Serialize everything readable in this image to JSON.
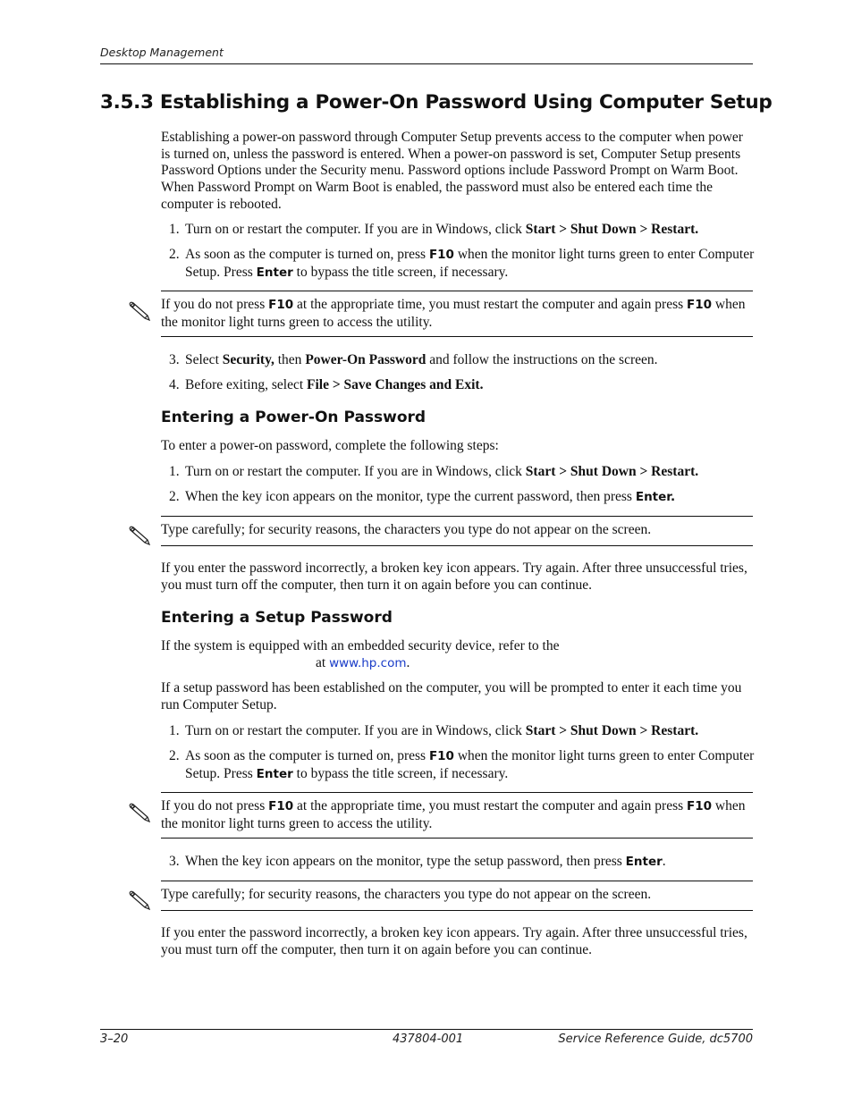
{
  "header": {
    "running_title": "Desktop Management"
  },
  "section": {
    "title": "3.5.3 Establishing a Power-On Password Using Computer Setup",
    "intro": "Establishing a power-on password through Computer Setup prevents access to the computer when power is turned on, unless the password is entered. When a power-on password is set, Computer Setup presents Password Options under the Security menu. Password options include Password Prompt on Warm Boot. When Password Prompt on Warm Boot is enabled, the password must also be entered each time the computer is rebooted.",
    "steps_a": [
      {
        "num": "1.",
        "pre": "Turn on or restart the computer. If you are in Windows, click ",
        "bold": "Start > Shut Down > Restart."
      },
      {
        "num": "2.",
        "pre": "As soon as the computer is turned on, press ",
        "key1": "F10",
        "mid": " when the monitor light turns green to enter Computer Setup. Press ",
        "key2": "Enter",
        "post": " to bypass the title screen, if necessary."
      }
    ],
    "note_1": {
      "pre": "If you do not press ",
      "key1": "F10",
      "mid": " at the appropriate time, you must restart the computer and again press ",
      "key2": "F10",
      "post": " when the monitor light turns green to access the utility."
    },
    "steps_b": [
      {
        "num": "3.",
        "pre": "Select ",
        "bold1": "Security,",
        "mid": " then ",
        "bold2": "Power-On Password",
        "post": " and follow the instructions on the screen."
      },
      {
        "num": "4.",
        "pre": "Before exiting, select ",
        "bold": "File > Save Changes and Exit."
      }
    ]
  },
  "entering_power_on": {
    "heading": "Entering a Power-On Password",
    "intro": "To enter a power-on password, complete the following steps:",
    "steps": [
      {
        "num": "1.",
        "pre": "Turn on or restart the computer. If you are in Windows, click ",
        "bold": "Start > Shut Down > Restart."
      },
      {
        "num": "2.",
        "pre": "When the key icon appears on the monitor, type the current password, then press ",
        "key": "Enter."
      }
    ],
    "note": "Type carefully; for security reasons, the characters you type do not appear on the screen.",
    "after": "If you enter the password incorrectly, a broken key icon appears. Try again. After three unsuccessful tries, you must turn off the computer, then turn it on again before you can continue."
  },
  "entering_setup": {
    "heading": "Entering a Setup Password",
    "embedded_pre": "If the system is equipped with an embedded security device, refer to the",
    "embedded_at": "at ",
    "link": "www.hp.com",
    "embedded_post": ".",
    "intro": "If a setup password has been established on the computer, you will be prompted to enter it each time you run Computer Setup.",
    "steps": [
      {
        "num": "1.",
        "pre": "Turn on or restart the computer. If you are in Windows, click ",
        "bold": "Start > Shut Down > Restart."
      },
      {
        "num": "2.",
        "pre": "As soon as the computer is turned on, press ",
        "key1": "F10",
        "mid": " when the monitor light turns green to enter Computer Setup. Press ",
        "key2": "Enter",
        "post": " to bypass the title screen, if necessary."
      }
    ],
    "note_1": {
      "pre": "If you do not press ",
      "key1": "F10",
      "mid": " at the appropriate time, you must restart the computer and again press ",
      "key2": "F10",
      "post": " when the monitor light turns green to access the utility."
    },
    "step3": {
      "num": "3.",
      "pre": "When the key icon appears on the monitor, type the setup password, then press ",
      "key": "Enter",
      "post": "."
    },
    "note_2": "Type carefully; for security reasons, the characters you type do not appear on the screen.",
    "after": "If you enter the password incorrectly, a broken key icon appears. Try again. After three unsuccessful tries, you must turn off the computer, then turn it on again before you can continue."
  },
  "footer": {
    "page": "3–20",
    "doc_number": "437804-001",
    "guide": "Service Reference Guide, dc5700"
  }
}
